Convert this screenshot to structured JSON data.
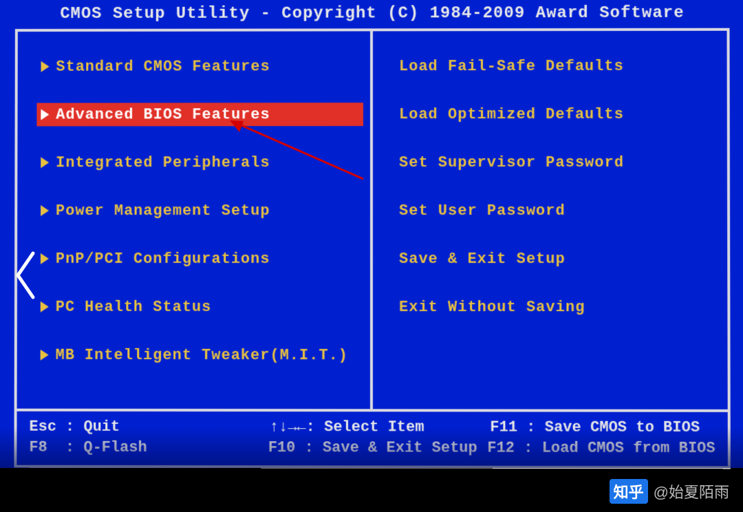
{
  "title": "CMOS Setup Utility - Copyright (C) 1984-2009 Award Software",
  "menu": {
    "left": [
      {
        "label": "Standard CMOS Features",
        "selected": false
      },
      {
        "label": "Advanced BIOS Features",
        "selected": true
      },
      {
        "label": "Integrated Peripherals",
        "selected": false
      },
      {
        "label": "Power Management Setup",
        "selected": false
      },
      {
        "label": "PnP/PCI Configurations",
        "selected": false
      },
      {
        "label": "PC Health Status",
        "selected": false
      },
      {
        "label": "MB Intelligent Tweaker(M.I.T.)",
        "selected": false
      }
    ],
    "right": [
      {
        "label": "Load Fail-Safe Defaults"
      },
      {
        "label": "Load Optimized Defaults"
      },
      {
        "label": "Set Supervisor Password"
      },
      {
        "label": "Set User Password"
      },
      {
        "label": "Save & Exit Setup"
      },
      {
        "label": "Exit Without Saving"
      }
    ]
  },
  "footer": {
    "esc": "Esc : Quit",
    "f8": "F8  : Q-Flash",
    "arrows": "↑↓→←: Select Item",
    "f10": "F10 : Save & Exit Setup",
    "f11": "F11 : Save CMOS to BIOS",
    "f12": "F12 : Load CMOS from BIOS"
  },
  "watermark": {
    "logo": "知乎",
    "text": "@始夏陌雨"
  }
}
